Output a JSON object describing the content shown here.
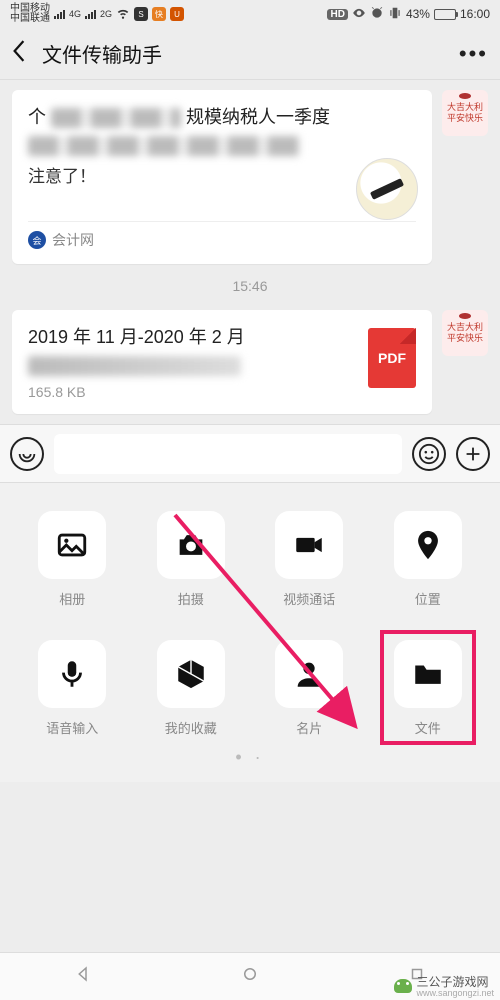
{
  "status": {
    "carrier1": "中国移动",
    "carrier2": "中国联通",
    "net1": "4G",
    "net2": "2G",
    "hd": "HD",
    "battery_pct": "43%",
    "time": "16:00"
  },
  "header": {
    "title": "文件传输助手"
  },
  "chat": {
    "message1": {
      "title_prefix": "个",
      "title_suffix": "规模纳税人一季度",
      "note": "注意了！",
      "source": "会计网"
    },
    "time1": "15:46",
    "message2": {
      "title": "2019 年 11 月-2020 年 2 月",
      "pdf_label": "PDF",
      "size": "165.8 KB"
    }
  },
  "panel": {
    "items": [
      {
        "label": "相册"
      },
      {
        "label": "拍摄"
      },
      {
        "label": "视频通话"
      },
      {
        "label": "位置"
      },
      {
        "label": "语音输入"
      },
      {
        "label": "我的收藏"
      },
      {
        "label": "名片"
      },
      {
        "label": "文件"
      }
    ]
  },
  "watermark": {
    "name": "三公子游戏网",
    "url": "www.sangongzi.net"
  }
}
